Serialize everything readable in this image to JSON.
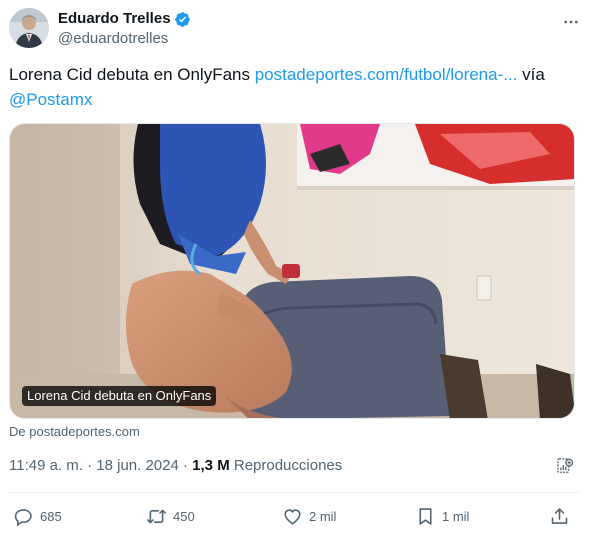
{
  "author": {
    "name": "Eduardo Trelles",
    "handle": "@eduardotrelles",
    "verified_icon": "verified-badge-icon"
  },
  "tweet": {
    "text_prefix": "Lorena Cid debuta en OnlyFans ",
    "link_text": "postadeportes.com/futbol/lorena-...",
    "text_middle": " vía",
    "mention": "@Postamx"
  },
  "card": {
    "caption": "Lorena Cid debuta en OnlyFans",
    "source": "De postadeportes.com"
  },
  "meta": {
    "timestamp": "11:49 a. m. · 18 jun. 2024 · ",
    "views_count": "1,3 M",
    "views_label": " Reproducciones"
  },
  "actions": {
    "replies": "685",
    "reposts": "450",
    "likes": "2 mil",
    "bookmarks": "1 mil"
  },
  "colors": {
    "accent": "#1d9bf0",
    "text": "#0f1419",
    "secondary": "#536471"
  }
}
